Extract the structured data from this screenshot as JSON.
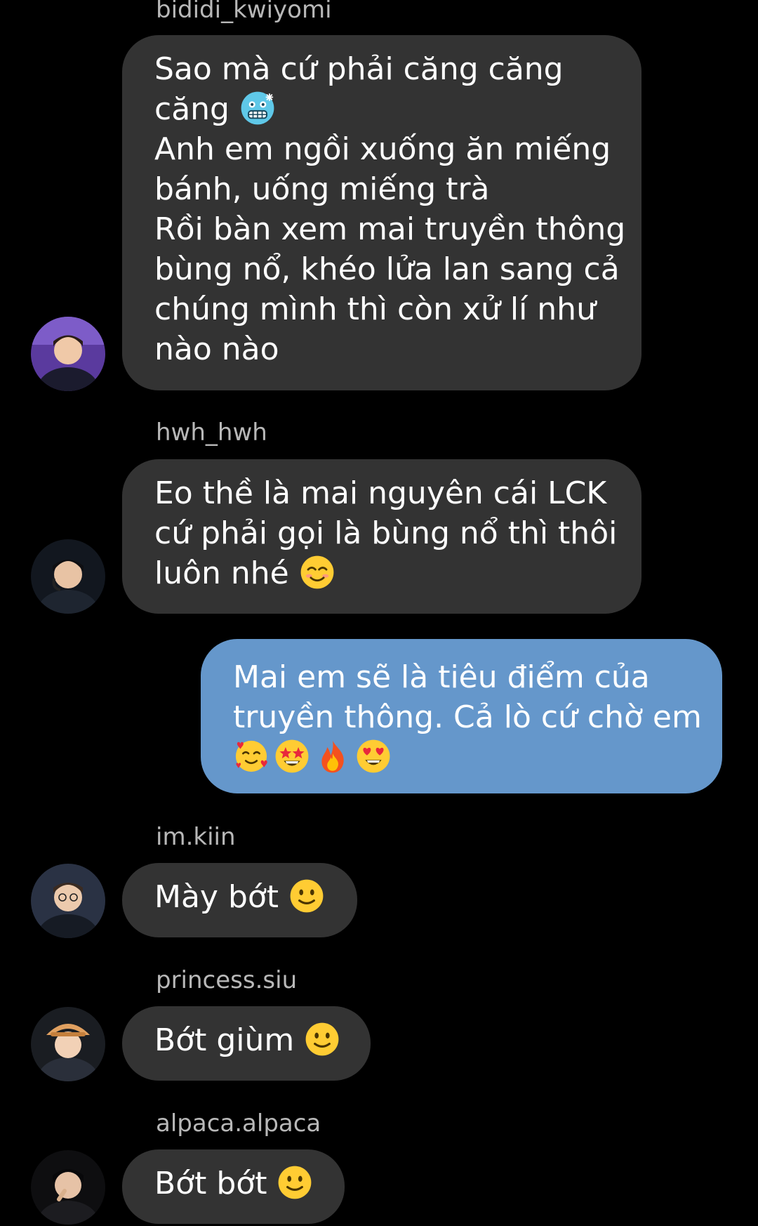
{
  "messages": [
    {
      "sender": "bididi_kwiyomi",
      "direction": "incoming",
      "lines": [
        "Sao mà cứ phải căng căng",
        "căng",
        "Anh em ngồi xuống ăn miếng",
        "bánh, uống miếng trà",
        "Rồi bàn xem mai truyền thông",
        "bùng nổ, khéo lửa lan sang cả",
        "chúng mình thì còn xử lí như",
        "nào nào"
      ],
      "emoji": [
        "cold-face-emoji"
      ]
    },
    {
      "sender": "hwh_hwh",
      "direction": "incoming",
      "lines": [
        "Eo thề là mai nguyên cái LCK",
        "cứ phải gọi là bùng nổ thì thôi",
        "luôn nhé"
      ],
      "emoji": [
        "smiling-face-emoji"
      ]
    },
    {
      "sender": "",
      "direction": "outgoing",
      "lines": [
        "Mai em sẽ là tiêu điểm của",
        "truyền thông. Cả lò cứ chờ em"
      ],
      "emoji": [
        "smiling-face-with-hearts-emoji",
        "star-struck-emoji",
        "fire-emoji",
        "heart-eyes-emoji"
      ]
    },
    {
      "sender": "im.kiin",
      "direction": "incoming",
      "lines": [
        "Mày bớt"
      ],
      "emoji": [
        "slightly-smiling-face-emoji"
      ]
    },
    {
      "sender": "princess.siu",
      "direction": "incoming",
      "lines": [
        "Bớt giùm"
      ],
      "emoji": [
        "slightly-smiling-face-emoji"
      ]
    },
    {
      "sender": "alpaca.alpaca",
      "direction": "incoming",
      "lines": [
        "Bớt bớt"
      ],
      "emoji": [
        "slightly-smiling-face-emoji"
      ]
    }
  ],
  "colors": {
    "background": "#000000",
    "incoming_bubble": "#333333",
    "outgoing_bubble": "#6597cb",
    "sender_text": "#b8b8b8",
    "message_text": "#ffffff"
  }
}
